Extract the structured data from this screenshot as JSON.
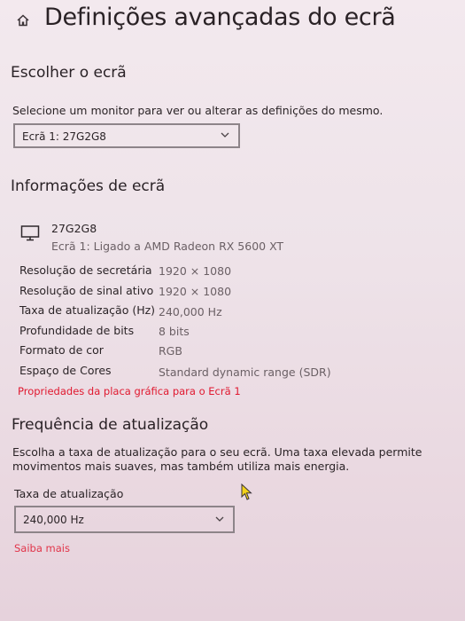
{
  "header": {
    "title": "Definições avançadas do ecrã"
  },
  "choose_display": {
    "heading": "Escolher o ecrã",
    "description": "Selecione um monitor para ver ou alterar as definições do mesmo.",
    "selected": "Ecrã 1: 27G2G8"
  },
  "display_info": {
    "heading": "Informações de ecrã",
    "monitor_name": "27G2G8",
    "monitor_connection": "Ecrã 1: Ligado a AMD Radeon RX 5600 XT",
    "rows": [
      {
        "label": "Resolução de secretária",
        "value": "1920 × 1080"
      },
      {
        "label": "Resolução de sinal ativo",
        "value": "1920 × 1080"
      },
      {
        "label": "Taxa de atualização (Hz)",
        "value": "240,000 Hz"
      },
      {
        "label": "Profundidade de bits",
        "value": "8 bits"
      },
      {
        "label": "Formato de cor",
        "value": "RGB"
      },
      {
        "label": "Espaço de Cores",
        "value": "Standard dynamic range (SDR)"
      }
    ],
    "adapter_link": "Propriedades da placa gráfica para o Ecrã 1"
  },
  "refresh": {
    "heading": "Frequência de atualização",
    "description_line1": "Escolha a taxa de atualização para o seu ecrã. Uma taxa elevada permite",
    "description_line2": "movimentos mais suaves, mas também utiliza mais energia.",
    "rate_label": "Taxa de atualização",
    "rate_selected": "240,000 Hz",
    "learn_more": "Saiba mais"
  },
  "colors": {
    "accent_link": "#e0182f",
    "border": "#8d8489"
  }
}
